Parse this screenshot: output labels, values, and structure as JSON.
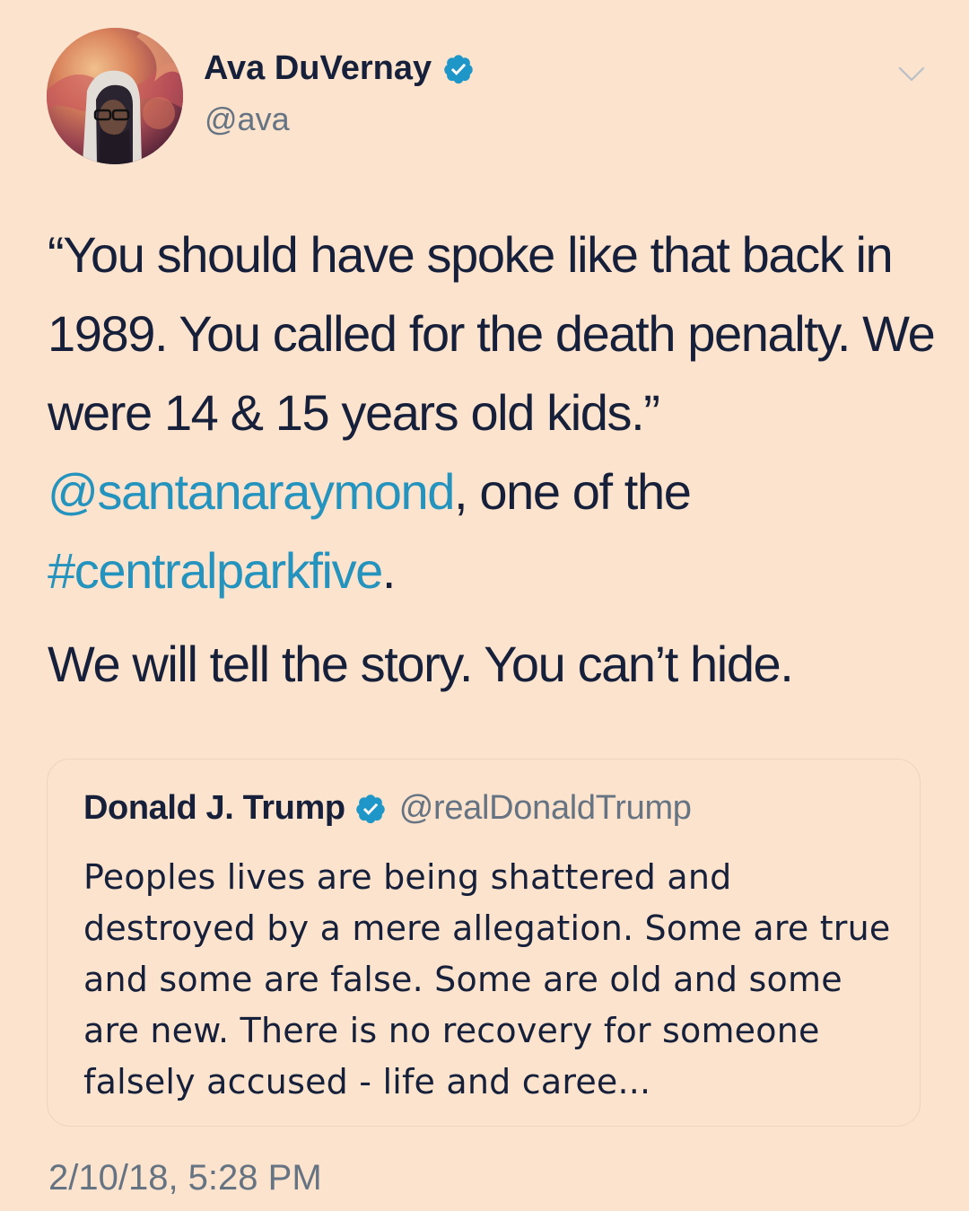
{
  "tweet": {
    "author": {
      "name": "Ava DuVernay",
      "handle": "@ava",
      "verified": true,
      "avatar_icon": "avatar-photo"
    },
    "menu_icon": "chevron-down-icon",
    "body": {
      "line1_text": "“You should have spoke like that back in 1989. You called for the death penalty. We were 14 & 15 years old kids.” ",
      "mention": "@santanaraymond",
      "line1_after_mention": ", one of the ",
      "hashtag": "#centralparkfive",
      "line1_end": ".",
      "line2": "We will tell the story. You can’t hide."
    },
    "quoted_tweet": {
      "name": "Donald J. Trump",
      "handle": "@realDonaldTrump",
      "verified": true,
      "text": "Peoples lives are being shattered and destroyed by a mere allegation. Some are true and some are false. Some are old and some are new. There is no recovery for someone falsely accused - life and caree..."
    },
    "timestamp": "2/10/18, 5:28 PM",
    "colors": {
      "background": "#fbe3cd",
      "text": "#17203a",
      "secondary_text": "#657382",
      "link": "#2493be",
      "verified_badge": "#1f96c8"
    }
  }
}
